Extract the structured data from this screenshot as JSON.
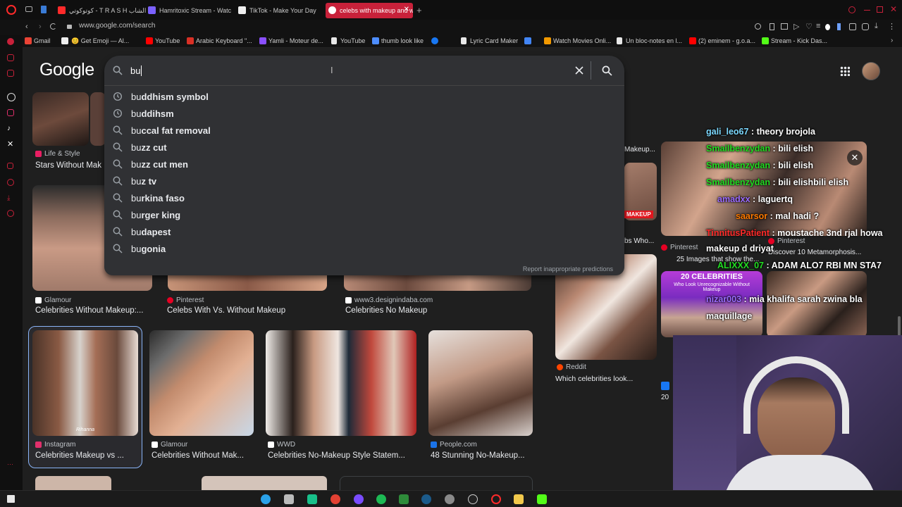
{
  "tabs": [
    {
      "title": "كوتوكوتي - T R A S H الشاب",
      "fav": "#ff2a2a"
    },
    {
      "title": "Hamritoxic Stream - Watc",
      "fav": "#7b61ff"
    },
    {
      "title": "TikTok - Make Your Day",
      "fav": "#ffffff"
    },
    {
      "title": "celebs with makeup and w",
      "fav": "#ffffff",
      "active": true
    }
  ],
  "address": {
    "url": "www.google.com/search"
  },
  "bookmarks": [
    {
      "label": "Gmail",
      "color": "#ea4335"
    },
    {
      "label": "😊 Get Emoji — Al...",
      "color": "#f4b400"
    },
    {
      "label": "YouTube",
      "color": "#ff0000"
    },
    {
      "label": "Arabic Keyboard \"...",
      "color": "#d93025"
    },
    {
      "label": "Yamli - Moteur de...",
      "color": "#8a4fff"
    },
    {
      "label": "YouTube",
      "color": "#e8e8e8"
    },
    {
      "label": "thumb look like",
      "color": "#4d8dff"
    },
    {
      "label": "Lyric Card Maker",
      "color": "#e8e8e8"
    },
    {
      "label": "Watch Movies Onli...",
      "color": "#f29900"
    },
    {
      "label": "Un bloc-notes en l...",
      "color": "#e8e8e8"
    },
    {
      "label": "(2) eminem - g.o.a...",
      "color": "#ff0000"
    },
    {
      "label": "Stream - Kick Das...",
      "color": "#53fc18"
    }
  ],
  "google": {
    "logo": "Google"
  },
  "search": {
    "query": "bu",
    "suggestions": [
      {
        "prefix": "bu",
        "rest": "ddhism symbol",
        "icon": "history-icon"
      },
      {
        "prefix": "bu",
        "rest": "ddihsm",
        "icon": "history-icon"
      },
      {
        "prefix": "bu",
        "rest": "ccal fat removal",
        "icon": "search-icon"
      },
      {
        "prefix": "bu",
        "rest": "zz cut",
        "icon": "search-icon"
      },
      {
        "prefix": "bu",
        "rest": "zz cut men",
        "icon": "search-icon"
      },
      {
        "prefix": "bu",
        "rest": "z tv",
        "icon": "search-icon"
      },
      {
        "prefix": "bu",
        "rest": "rkina faso",
        "icon": "search-icon"
      },
      {
        "prefix": "bu",
        "rest": "rger king",
        "icon": "search-icon"
      },
      {
        "prefix": "bu",
        "rest": "dapest",
        "icon": "search-icon"
      },
      {
        "prefix": "bu",
        "rest": "gonia",
        "icon": "search-icon"
      }
    ],
    "report": "Report inappropriate predictions"
  },
  "results": {
    "row0": [
      {
        "source": "Life & Style",
        "caption": "Stars Without Mak",
        "sicolor": "#e91e63"
      }
    ],
    "row0_right": {
      "caption": "Makeup..."
    },
    "row1": [
      {
        "source": "Glamour",
        "caption": "Celebrities Without Makeup:...",
        "sicolor": "#ffffff"
      },
      {
        "source": "Pinterest",
        "caption": "Celebs With Vs. Without Makeup",
        "sicolor": "#e60023"
      },
      {
        "source": "www3.designindaba.com",
        "caption": "Celebrities No Makeup",
        "sicolor": "#ffffff"
      }
    ],
    "row1_right": {
      "caption": "bs Who..."
    },
    "row2": [
      {
        "source": "Instagram",
        "caption": "Celebrities Makeup vs ...",
        "sicolor": "#e1306c"
      },
      {
        "source": "Glamour",
        "caption": "Celebrities Without Mak...",
        "sicolor": "#ffffff"
      },
      {
        "source": "WWD",
        "caption": "Celebrities No-Makeup Style Statem...",
        "sicolor": "#ffffff"
      },
      {
        "source": "People.com",
        "caption": "48 Stunning No-Makeup...",
        "sicolor": "#1a73e8"
      }
    ],
    "reddit": {
      "source": "Reddit",
      "caption": "Which celebrities look...",
      "sicolor": "#ff4500"
    },
    "pinterest_side": {
      "source": "Pinterest",
      "caption": "25 Images that show the..."
    },
    "pinterest_side2": {
      "source": "Pinterest",
      "caption": "Discover 10 Metamorphosis..."
    },
    "thumb_labels": {
      "rihanna": "Rihanna",
      "makeup_badge": "MAKEUP",
      "celebs_title": "20 CELEBRITIES",
      "celebs_sub": "Who Look Unrecognizable Without Makeup"
    },
    "fb_caption": "20"
  },
  "chat": [
    {
      "user": "gali_leo67",
      "msg": "theory brojola",
      "color": "#7cd9ff"
    },
    {
      "user": "Smailbenzydan",
      "msg": "bili elish",
      "color": "#22dd22"
    },
    {
      "user": "Smailbenzydan",
      "msg": "bili elish",
      "color": "#22dd22"
    },
    {
      "user": "Smailbenzydan",
      "msg": "bili elishbili elish",
      "color": "#22dd22"
    },
    {
      "user": "amadxx",
      "msg": "laguertq",
      "color": "#9b6bff"
    },
    {
      "user": "saarsor",
      "msg": "mal hadi ?",
      "color": "#ff7a00"
    },
    {
      "user": "TinnitusPatient",
      "msg": "moustache 3nd rjal howa",
      "color": "#ff2a2a"
    },
    {
      "user": "",
      "msg": "makeup d driyat",
      "color": "#ffffff"
    },
    {
      "user": "ALIXXX_07",
      "msg": "ADAM ALO7 RBI MN STA7",
      "color": "#22dd22"
    },
    {
      "user": "nizar003",
      "msg": "mia khalifa sarah zwina bla",
      "color": "#9b6bff"
    },
    {
      "user": "",
      "msg": "maquillage",
      "color": "#ffffff"
    }
  ],
  "icons": [
    "search-icon",
    "clear-icon",
    "apps-icon",
    "history-icon",
    "close-icon"
  ]
}
